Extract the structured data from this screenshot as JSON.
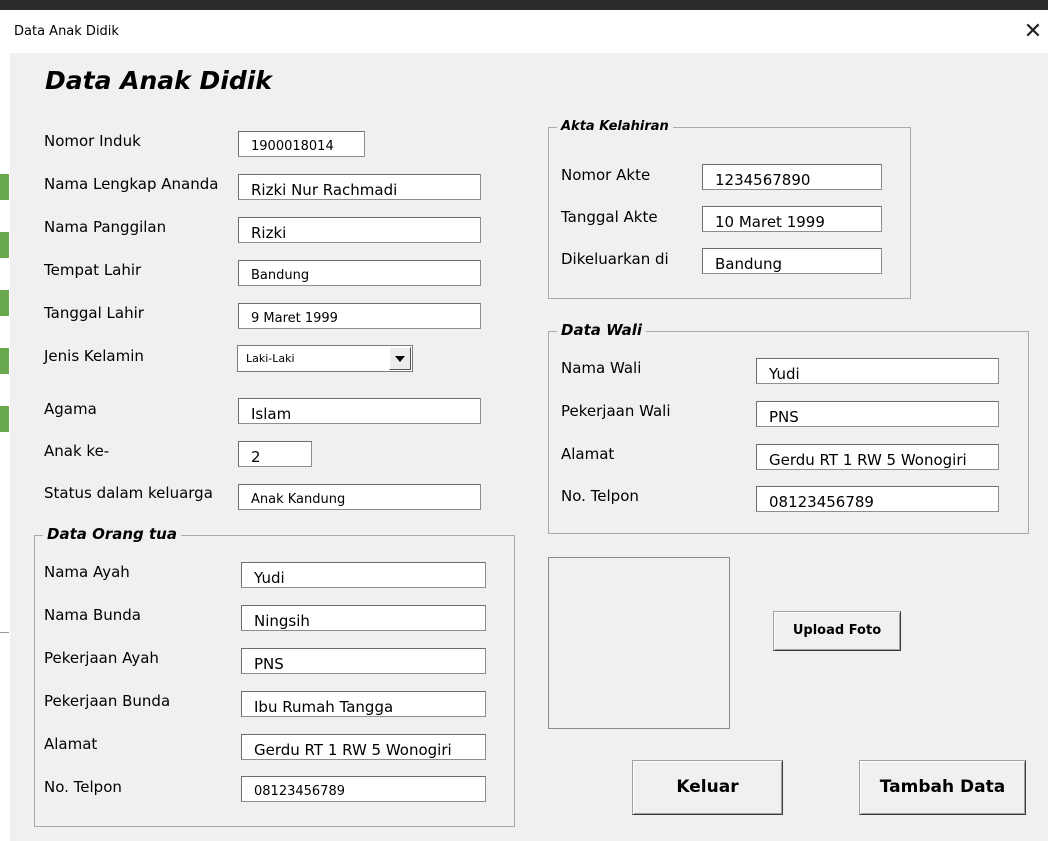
{
  "window": {
    "title": "Data Anak Didik",
    "close_glyph": "✕"
  },
  "heading": "Data Anak Didik",
  "student": {
    "nomor_induk": {
      "label": "Nomor Induk",
      "value": "1900018014"
    },
    "nama_lengkap": {
      "label": "Nama Lengkap Ananda",
      "value": "Rizki Nur Rachmadi"
    },
    "nama_panggilan": {
      "label": "Nama Panggilan",
      "value": "Rizki"
    },
    "tempat_lahir": {
      "label": "Tempat Lahir",
      "value": "Bandung"
    },
    "tanggal_lahir": {
      "label": "Tanggal Lahir",
      "value": "9 Maret 1999"
    },
    "jenis_kelamin": {
      "label": "Jenis Kelamin",
      "value": "Laki-Laki"
    },
    "agama": {
      "label": "Agama",
      "value": "Islam"
    },
    "anak_ke": {
      "label": "Anak ke-",
      "value": "2"
    },
    "status": {
      "label": "Status dalam keluarga",
      "value": "Anak Kandung"
    }
  },
  "parents": {
    "title": "Data Orang tua",
    "nama_ayah": {
      "label": "Nama Ayah",
      "value": "Yudi"
    },
    "nama_bunda": {
      "label": "Nama Bunda",
      "value": "Ningsih"
    },
    "pekerjaan_ayah": {
      "label": "Pekerjaan Ayah",
      "value": "PNS"
    },
    "pekerjaan_bunda": {
      "label": "Pekerjaan Bunda",
      "value": "Ibu Rumah Tangga"
    },
    "alamat": {
      "label": "Alamat",
      "value": "Gerdu RT 1 RW 5 Wonogiri"
    },
    "telpon": {
      "label": "No. Telpon",
      "value": "08123456789"
    }
  },
  "birth_cert": {
    "title": "Akta Kelahiran",
    "nomor": {
      "label": "Nomor Akte",
      "value": "1234567890"
    },
    "tanggal": {
      "label": "Tanggal Akte",
      "value": "10 Maret 1999"
    },
    "tempat": {
      "label": "Dikeluarkan di",
      "value": "Bandung"
    }
  },
  "guardian": {
    "title": "Data Wali",
    "nama": {
      "label": "Nama Wali",
      "value": "Yudi"
    },
    "pekerjaan": {
      "label": "Pekerjaan Wali",
      "value": "PNS"
    },
    "alamat": {
      "label": "Alamat",
      "value": "Gerdu RT 1 RW 5 Wonogiri"
    },
    "telpon": {
      "label": "No. Telpon",
      "value": "08123456789"
    }
  },
  "buttons": {
    "upload": "Upload Foto",
    "exit": "Keluar",
    "add": "Tambah Data"
  },
  "colors": {
    "form_bg": "#f0f0f0",
    "titlebar_bg": "#ffffff",
    "sheet_marker": "#6aa84f"
  }
}
